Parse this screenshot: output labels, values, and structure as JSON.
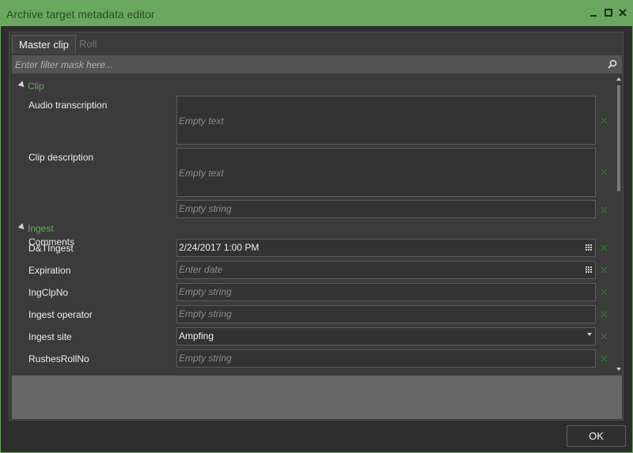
{
  "window": {
    "title": "Archive target metadata editor",
    "minimize_icon": "minimize-icon",
    "maximize_icon": "maximize-icon",
    "close_icon": "close-icon",
    "accent_color": "#6aa860"
  },
  "tabs": [
    {
      "label": "Master clip",
      "active": true
    },
    {
      "label": "Roll",
      "active": false
    }
  ],
  "filter": {
    "placeholder": "Enter filter mask here...",
    "icon": "search-icon"
  },
  "groups": [
    {
      "label": "Clip",
      "expanded": true,
      "fields": [
        {
          "label": "Audio transcription",
          "placeholder": "Empty text",
          "value": ""
        },
        {
          "label": "Clip description",
          "placeholder": "Empty text",
          "value": ""
        },
        {
          "label": "Comments",
          "placeholder": "Empty string",
          "value": ""
        }
      ]
    },
    {
      "label": "Ingest",
      "expanded": true,
      "fields": [
        {
          "label": "D&TIngest",
          "placeholder": "",
          "value": "2/24/2017 1:00 PM",
          "icon": "calendar-icon"
        },
        {
          "label": "Expiration",
          "placeholder": "Enter date",
          "value": "",
          "icon": "calendar-icon"
        },
        {
          "label": "IngClpNo",
          "placeholder": "Empty string",
          "value": ""
        },
        {
          "label": "Ingest operator",
          "placeholder": "Empty string",
          "value": ""
        },
        {
          "label": "Ingest site",
          "placeholder": "",
          "value": "Ampfing",
          "icon": "chevron-down-icon"
        },
        {
          "label": "RushesRollNo",
          "placeholder": "Empty string",
          "value": ""
        }
      ]
    }
  ],
  "buttons": {
    "ok_label": "OK"
  }
}
